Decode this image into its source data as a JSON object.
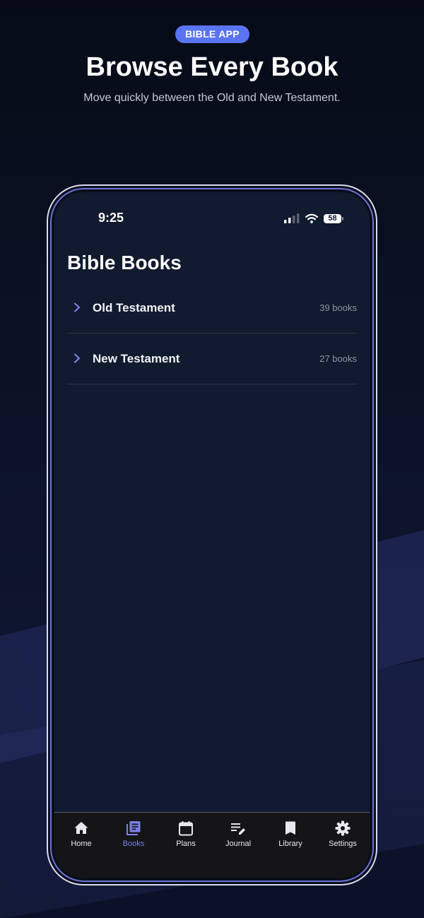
{
  "hero": {
    "badge": "BIBLE APP",
    "title": "Browse Every Book",
    "subtitle": "Move quickly between the Old and New Testament."
  },
  "status_bar": {
    "time": "9:25",
    "battery": "58"
  },
  "screen": {
    "title": "Bible Books",
    "sections": [
      {
        "label": "Old Testament",
        "count": "39 books"
      },
      {
        "label": "New Testament",
        "count": "27 books"
      }
    ]
  },
  "tab_bar": {
    "active": "Books",
    "tabs": [
      {
        "label": "Home",
        "icon": "home-icon"
      },
      {
        "label": "Books",
        "icon": "books-icon"
      },
      {
        "label": "Plans",
        "icon": "calendar-icon"
      },
      {
        "label": "Journal",
        "icon": "journal-edit-icon"
      },
      {
        "label": "Library",
        "icon": "bookmark-icon"
      },
      {
        "label": "Settings",
        "icon": "gear-icon"
      }
    ]
  },
  "colors": {
    "accent": "#5b74f2",
    "active_tab": "#7b81e8",
    "screen_background": "#111a2e",
    "tab_bar_background": "#151517"
  }
}
